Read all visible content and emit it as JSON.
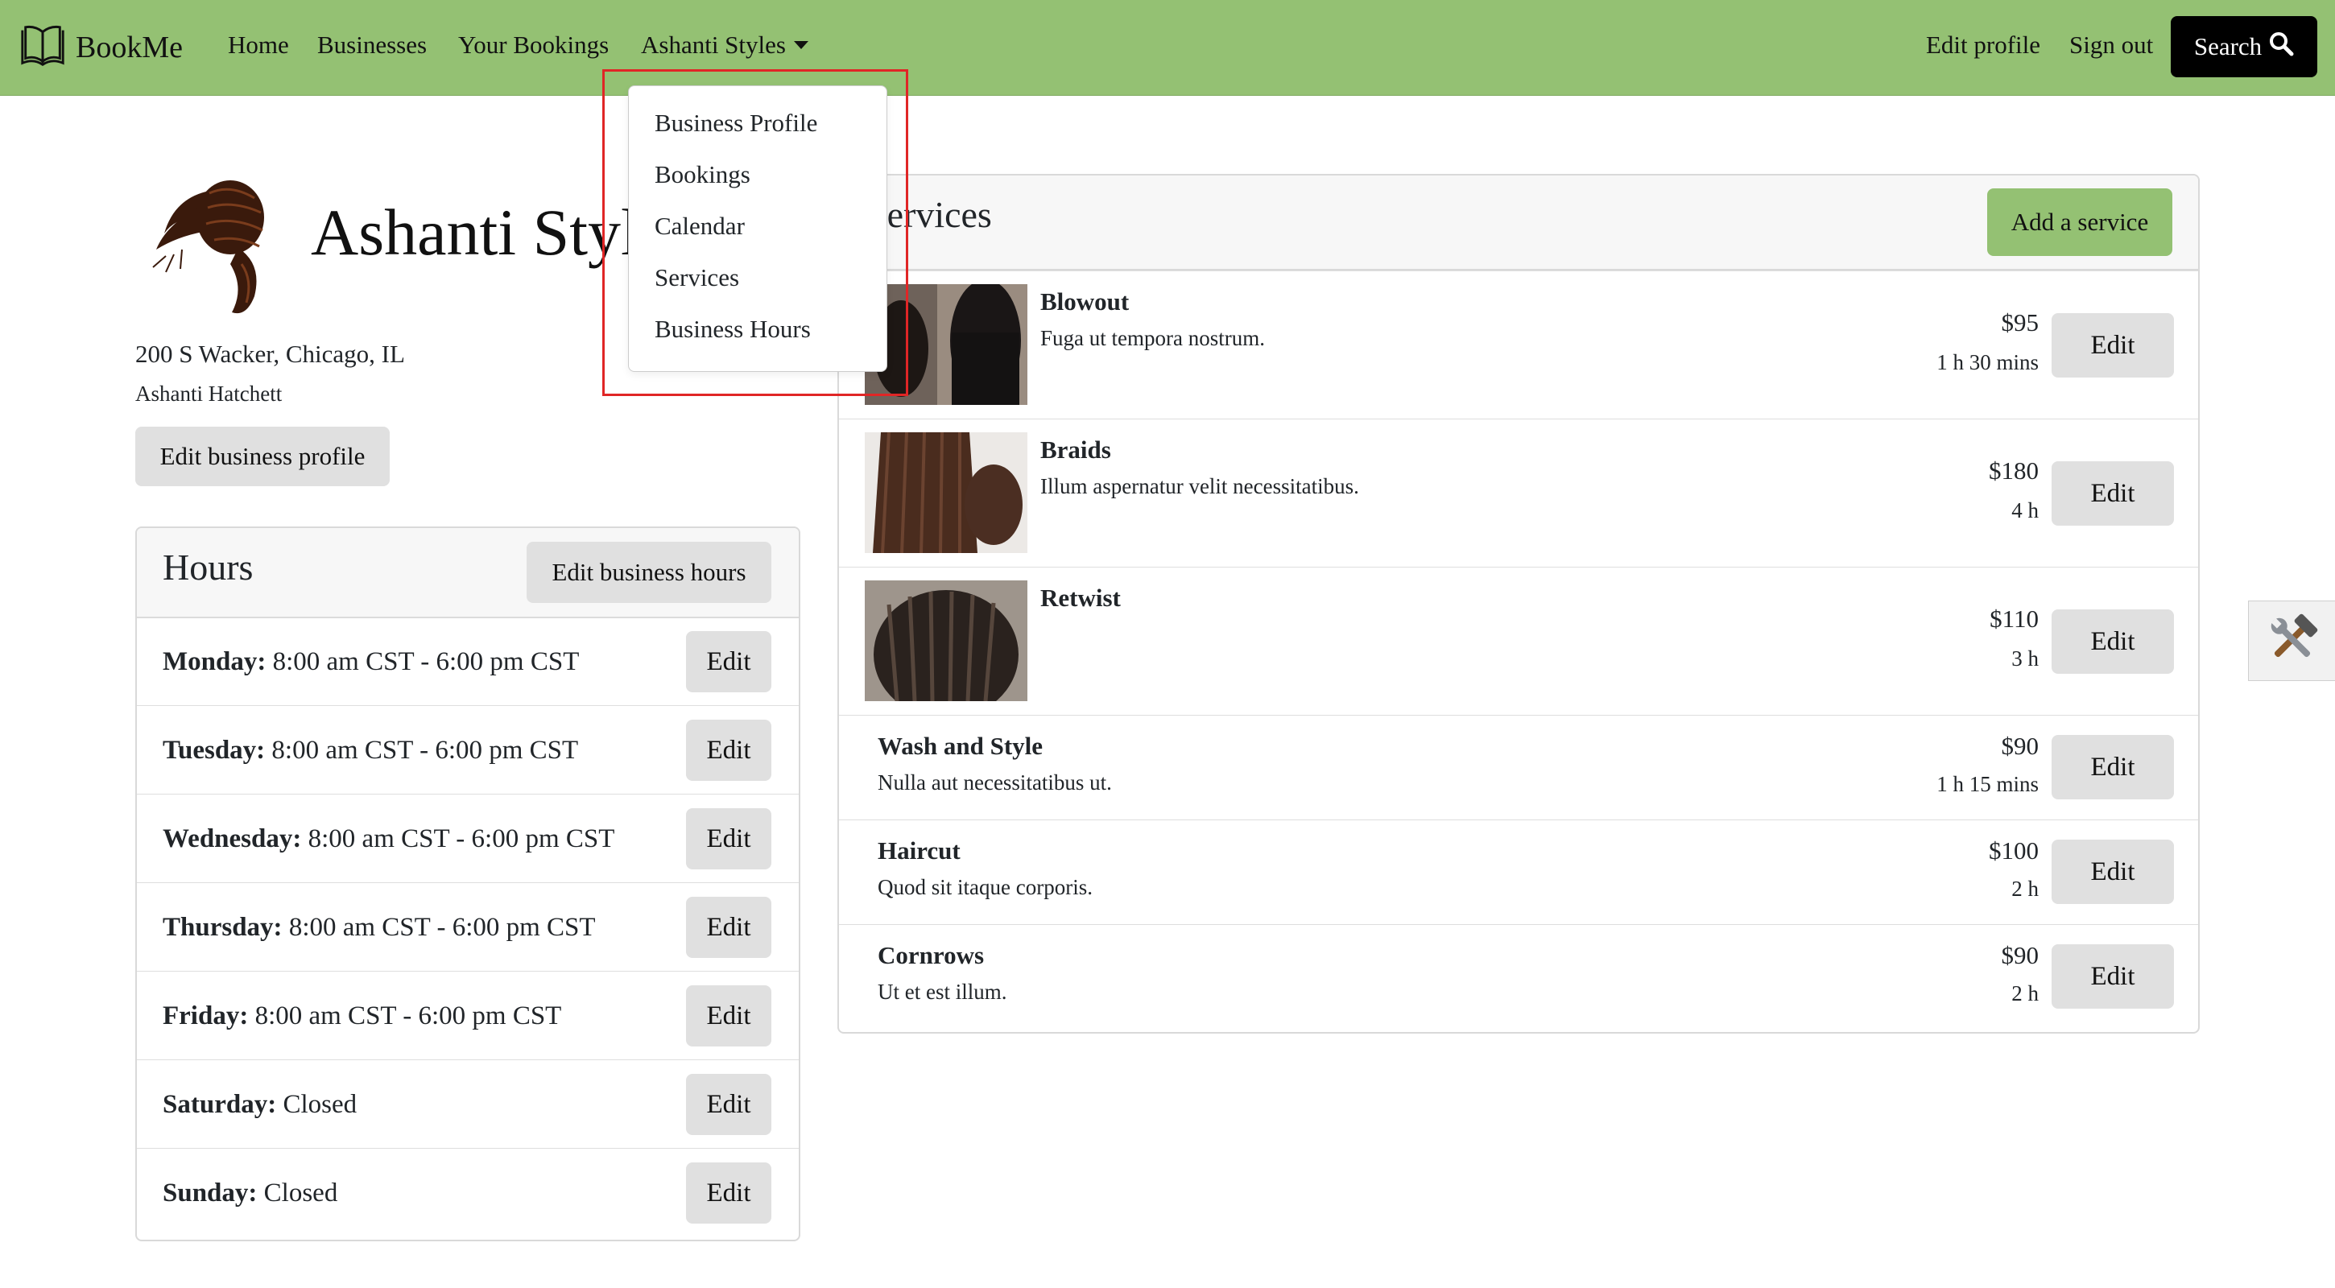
{
  "nav": {
    "brand": "BookMe",
    "home": "Home",
    "businesses": "Businesses",
    "your_bookings": "Your Bookings",
    "business_menu": "Ashanti Styles",
    "edit_profile": "Edit profile",
    "sign_out": "Sign out",
    "search": "Search"
  },
  "dropdown": {
    "items": [
      "Business Profile",
      "Bookings",
      "Calendar",
      "Services",
      "Business Hours"
    ]
  },
  "profile": {
    "title": "Ashanti Styles",
    "address": "200 S Wacker, Chicago, IL",
    "owner": "Ashanti Hatchett",
    "edit_button": "Edit business profile"
  },
  "hours": {
    "title": "Hours",
    "edit_button": "Edit business hours",
    "edit_label": "Edit",
    "rows": [
      {
        "day": "Monday:",
        "time": "8:00 am CST - 6:00 pm CST"
      },
      {
        "day": "Tuesday:",
        "time": "8:00 am CST - 6:00 pm CST"
      },
      {
        "day": "Wednesday:",
        "time": "8:00 am CST - 6:00 pm CST"
      },
      {
        "day": "Thursday:",
        "time": "8:00 am CST - 6:00 pm CST"
      },
      {
        "day": "Friday:",
        "time": "8:00 am CST - 6:00 pm CST"
      },
      {
        "day": "Saturday:",
        "time": "Closed"
      },
      {
        "day": "Sunday:",
        "time": "Closed"
      }
    ]
  },
  "services": {
    "title": "Services",
    "add_button": "Add a service",
    "edit_label": "Edit",
    "items": [
      {
        "name": "Blowout",
        "description": "Fuga ut tempora nostrum.",
        "price": "$95",
        "duration": "1 h 30 mins",
        "image": "hair-photo"
      },
      {
        "name": "Braids",
        "description": "Illum aspernatur velit necessitatibus.",
        "price": "$180",
        "duration": "4 h",
        "image": "hair-photo"
      },
      {
        "name": "Retwist",
        "description": "",
        "price": "$110",
        "duration": "3 h",
        "image": "hair-photo"
      },
      {
        "name": "Wash and Style",
        "description": "Nulla aut necessitatibus ut.",
        "price": "$90",
        "duration": "1 h 15 mins",
        "image": ""
      },
      {
        "name": "Haircut",
        "description": "Quod sit itaque corporis.",
        "price": "$100",
        "duration": "2 h",
        "image": ""
      },
      {
        "name": "Cornrows",
        "description": "Ut et est illum.",
        "price": "$90",
        "duration": "2 h",
        "image": ""
      }
    ]
  },
  "colors": {
    "navbar": "#94c173",
    "search_button": "#000000",
    "add_service_button": "#94c173",
    "gray_button": "#e0e0e0",
    "highlight_box": "#e02626"
  },
  "icons": {
    "brand": "open-book-icon",
    "search": "magnifier-icon",
    "tools": "hammer-wrench-icon"
  }
}
